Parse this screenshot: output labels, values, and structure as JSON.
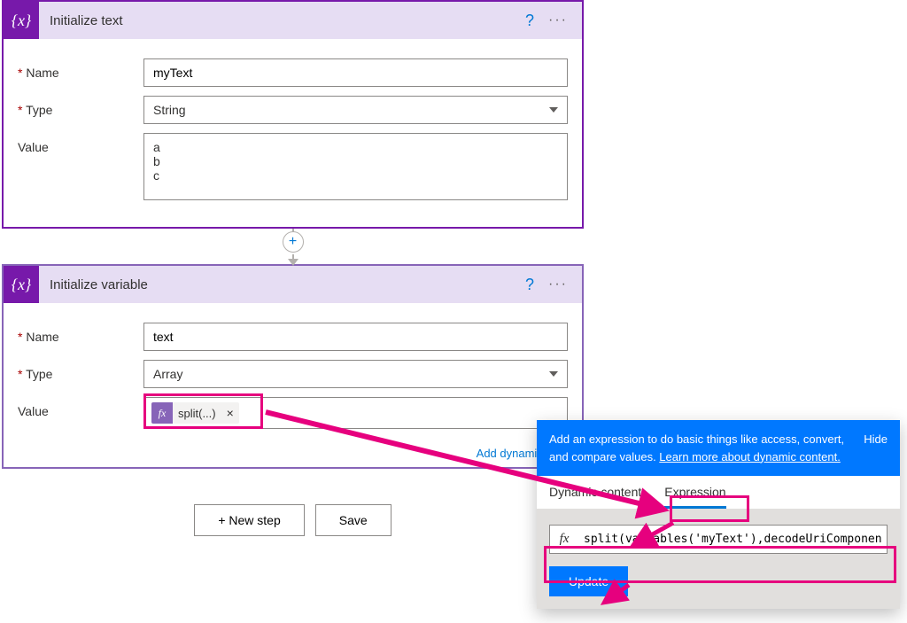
{
  "card1": {
    "title": "Initialize text",
    "help_icon": "?",
    "more_icon": "···",
    "name_label": "Name",
    "name_value": "myText",
    "type_label": "Type",
    "type_value": "String",
    "value_label": "Value",
    "value_text": "a\nb\nc"
  },
  "add_icon": "+",
  "card2": {
    "title": "Initialize variable",
    "help_icon": "?",
    "more_icon": "···",
    "name_label": "Name",
    "name_value": "text",
    "type_label": "Type",
    "type_value": "Array",
    "value_label": "Value",
    "pill_fx": "fx",
    "pill_text": "split(...)",
    "pill_close": "×",
    "dynamic_link": "Add dynamic cont"
  },
  "buttons": {
    "new_step": "+ New step",
    "save": "Save"
  },
  "panel": {
    "info": "Add an expression to do basic things like access, convert, and compare values. ",
    "link": "Learn more about dynamic content.",
    "hide": "Hide",
    "tab1": "Dynamic content",
    "tab2": "Expression",
    "fx": "fx",
    "expression_value": "split(variables('myText'),decodeUriComponent",
    "update": "Update"
  },
  "required": "*"
}
